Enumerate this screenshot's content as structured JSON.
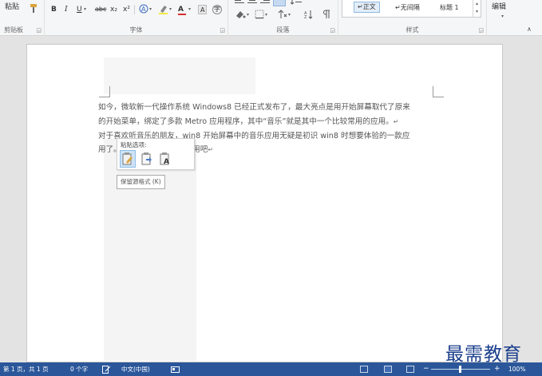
{
  "ribbon": {
    "clipboard": {
      "paste_label": "粘贴",
      "group_title": "剪贴板"
    },
    "font": {
      "bold": "B",
      "italic": "I",
      "underline": "U",
      "strike": "abc",
      "subscript": "x₂",
      "superscript": "x²",
      "font_color_letter": "A",
      "clear_letter": "A",
      "char_border": "字",
      "group_title": "字体"
    },
    "paragraph": {
      "group_title": "段落"
    },
    "styles": {
      "item_normal": "↵正文",
      "item_nospacing": "↵无间隔",
      "item_heading1": "标题 1",
      "group_title": "样式"
    },
    "editing": {
      "label": "编辑"
    }
  },
  "document": {
    "lines": [
      "如今，微软新一代操作系统 Windows8 已经正式发布了，最大亮点是用开始屏幕取代了原来",
      "的开始菜单，绑定了多款  Metro  应用程序，其中“音乐”就是其中一个比较常用的应用。",
      "对于喜欢听音乐的朋友，win8 开始屏幕中的音乐应用无疑是初识 win8 时想要体验的一款应",
      "用了。                          来体验下这款音乐应用吧"
    ]
  },
  "paste_options": {
    "title": "粘贴选项:",
    "tooltip": "保留源格式 (K)"
  },
  "status": {
    "page": "第 1 页，共 1 页",
    "words": "0 个字",
    "language": "中文(中国)",
    "zoom_minus": "−",
    "zoom_plus": "+",
    "zoom": "100%"
  },
  "watermark": "最需教育",
  "colors": {
    "status_bar": "#2b579a",
    "ribbon": "#f5f6f7",
    "watermark": "#1a3e8c"
  }
}
